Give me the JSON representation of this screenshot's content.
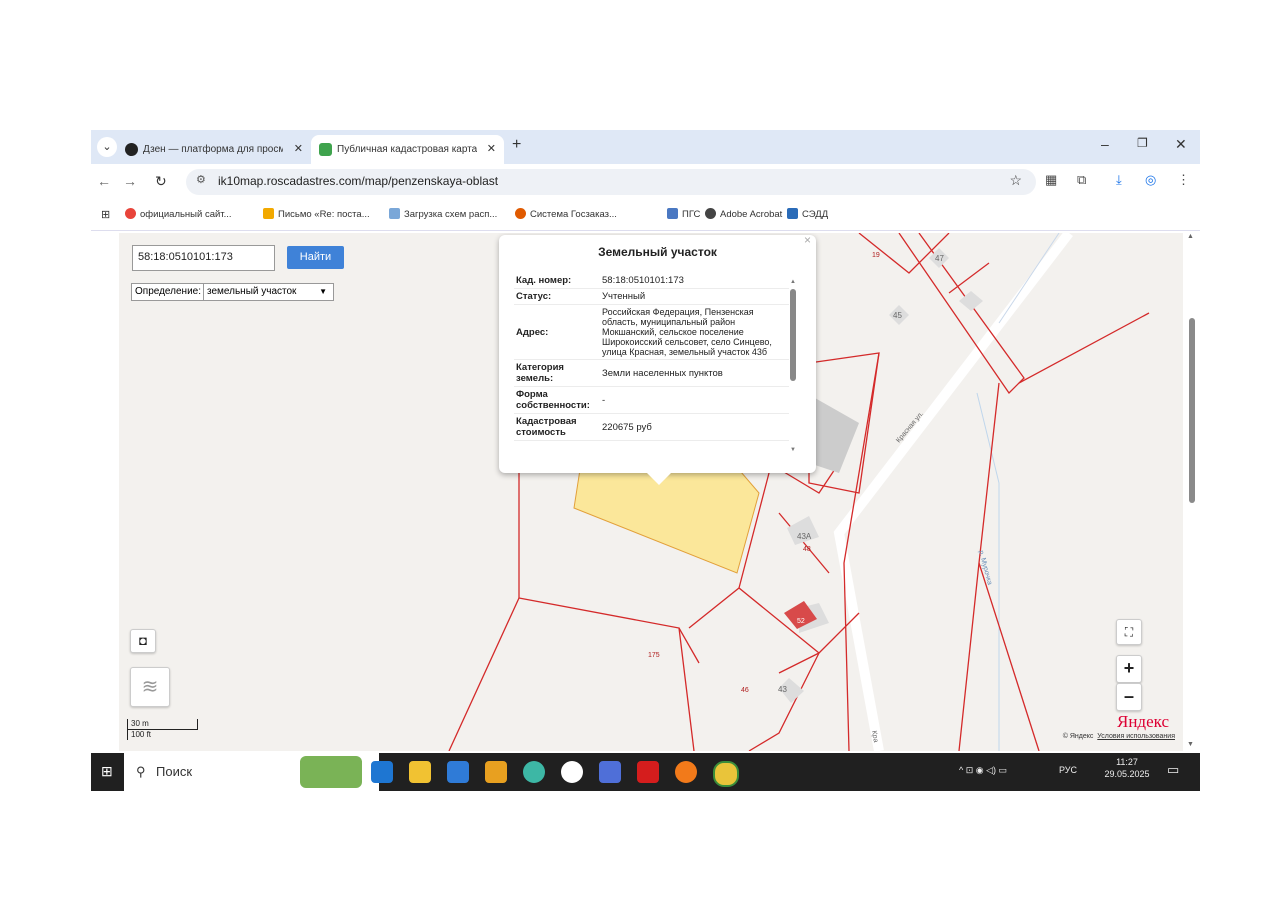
{
  "browser": {
    "tabs": [
      {
        "title": "Дзен — платформа для просм",
        "active": false,
        "icon_color": "#222222"
      },
      {
        "title": "Публичная кадастровая карта",
        "active": true,
        "icon_color": "#3fa34d"
      }
    ],
    "new_tab_label": "+",
    "url": "ik10map.roscadastres.com/map/penzenskaya-oblast",
    "window_controls": [
      "–",
      "❐",
      "✕"
    ]
  },
  "bookmarks": [
    {
      "label": "официальный сайт...",
      "icon_color": "#e8443a"
    },
    {
      "label": "Письмо «Re: поста...",
      "icon_color": "#f2a900"
    },
    {
      "label": "Загрузка схем расп...",
      "icon_color": "#7aa7d8"
    },
    {
      "label": "Система Госзаказ...",
      "icon_color": "#e05a00"
    },
    {
      "label": "ПГС",
      "icon_color": "#4a78c2"
    },
    {
      "label": "Adobe Acrobat",
      "icon_color": "#444444"
    },
    {
      "label": "СЭДД",
      "icon_color": "#2a6bb8"
    }
  ],
  "map": {
    "search_value": "58:18:0510101:173",
    "search_button": "Найти",
    "definition_label": "Определение:",
    "definition_value": "земельный участок",
    "scale_m": "30 m",
    "scale_ft": "100 ft",
    "zoom_in": "+",
    "zoom_out": "–",
    "logo": "Яндекс",
    "copyright": "© Яндекс",
    "terms_link": "Условия использования",
    "labels": {
      "n19": "19",
      "n47": "47",
      "n45": "45",
      "street1": "Красная ул.",
      "n43a": "43А",
      "n48": "48",
      "n52": "52",
      "n175": "175",
      "n46": "46",
      "n43": "43",
      "river": "р. Мурочка",
      "street2": "Кра"
    }
  },
  "popup": {
    "title": "Земельный участок",
    "close": "×",
    "rows": [
      {
        "key": "Кад. номер:",
        "value": "58:18:0510101:173"
      },
      {
        "key": "Статус:",
        "value": "Учтенный"
      },
      {
        "key": "Адрес:",
        "value": "Российская Федерация, Пензенская область, муниципальный район Мокшанский, сельское поселение Широкоисский сельсовет, село Синцево, улица Красная, земельный участок 43б"
      },
      {
        "key": "Категория земель:",
        "value": "Земли населенных пунктов"
      },
      {
        "key": "Форма собственности:",
        "value": "-"
      },
      {
        "key": "Кадастровая стоимость",
        "value": "220675 руб"
      }
    ]
  },
  "taskbar": {
    "search_label": "Поиск",
    "language": "РУС",
    "time": "11:27",
    "date": "29.05.2025"
  },
  "colors": {
    "accent": "#3f82d8",
    "parcel_line": "#d42a2a",
    "highlight": "#fbe79a"
  }
}
